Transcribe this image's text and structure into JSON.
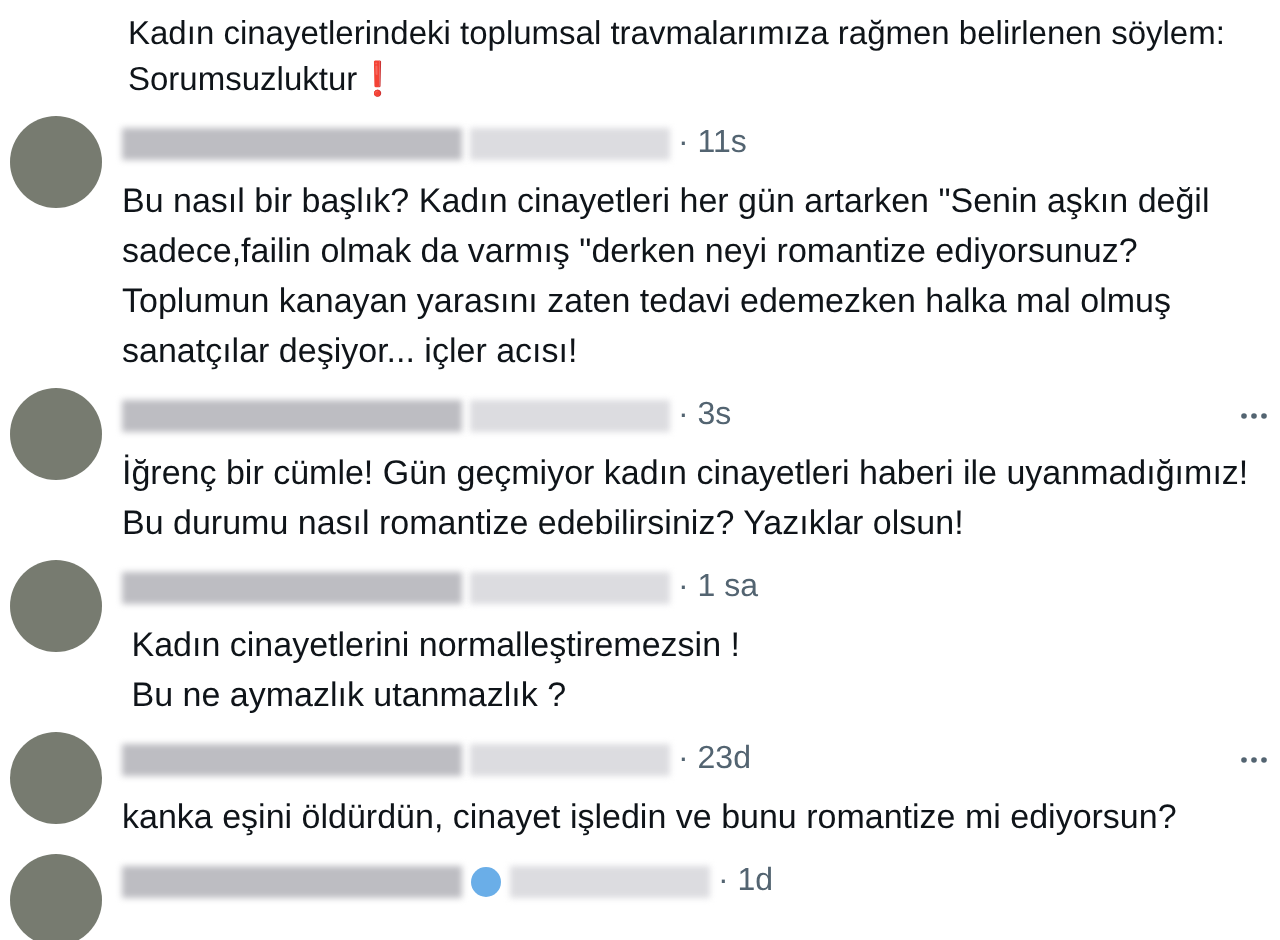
{
  "previous_tweet": {
    "text": "Kadın cinayetlerindeki toplumsal travmalarımıza rağmen belirlenen söylem:\nSorumsuzluktur",
    "emoji": "❗"
  },
  "replies": [
    {
      "time": "· 11s",
      "verified": false,
      "more_menu": false,
      "text": "Bu nasıl bir başlık? Kadın cinayetleri her gün artarken \"Senin aşkın değil\nsadece,failin olmak da varmış \"derken neyi romantize ediyorsunuz?\nToplumun kanayan yarasını zaten tedavi edemezken halka mal olmuş\nsanatçılar deşiyor... içler acısı!"
    },
    {
      "time": "· 3s",
      "verified": false,
      "more_menu": true,
      "text": "İğrenç bir cümle! Gün geçmiyor kadın cinayetleri haberi ile uyanmadığımız!\nBu durumu nasıl romantize edebilirsiniz? Yazıklar olsun!"
    },
    {
      "time": "· 1 sa",
      "verified": false,
      "more_menu": false,
      "text": " Kadın cinayetlerini normalleştiremezsin !\n Bu ne aymazlık utanmazlık ?"
    },
    {
      "time": "· 23d",
      "verified": false,
      "more_menu": true,
      "text": "kanka eşini öldürdün, cinayet işledin ve bunu romantize mi ediyorsun?"
    },
    {
      "time": "· 1d",
      "verified": true,
      "more_menu": false
    }
  ]
}
